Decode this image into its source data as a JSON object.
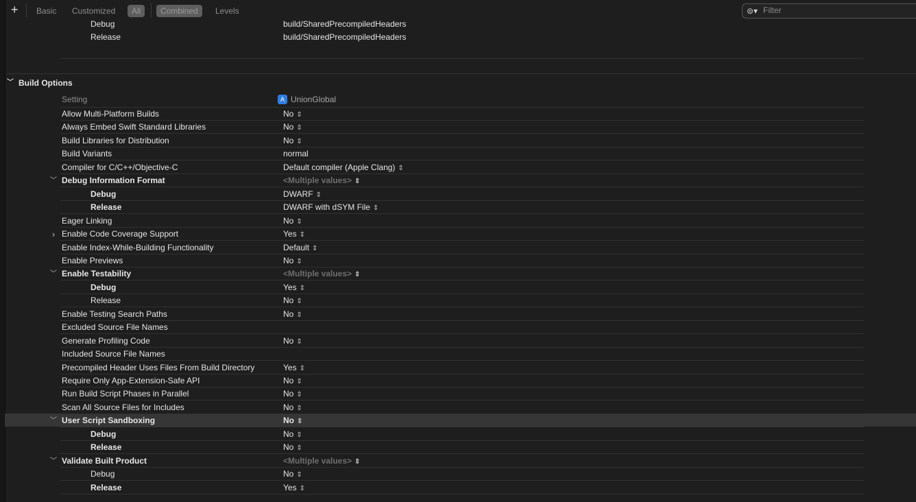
{
  "toolbar": {
    "tabs1": [
      "Basic",
      "Customized",
      "All"
    ],
    "tabs2": [
      "Combined",
      "Levels"
    ],
    "filter_placeholder": "Filter"
  },
  "top_rows": [
    {
      "name": "Debug",
      "value": "build/SharedPrecompiledHeaders"
    },
    {
      "name": "Release",
      "value": "build/SharedPrecompiledHeaders"
    }
  ],
  "section": {
    "title": "Build Options",
    "header_setting": "Setting",
    "header_target": "UnionGlobal"
  },
  "rows": [
    {
      "name": "Allow Multi-Platform Builds",
      "value": "No",
      "stepper": true
    },
    {
      "name": "Always Embed Swift Standard Libraries",
      "value": "No",
      "stepper": true
    },
    {
      "name": "Build Libraries for Distribution",
      "value": "No",
      "stepper": true
    },
    {
      "name": "Build Variants",
      "value": "normal"
    },
    {
      "name": "Compiler for C/C++/Objective-C",
      "value": "Default compiler (Apple Clang)",
      "stepper": true
    },
    {
      "name": "Debug Information Format",
      "value": "<Multiple values>",
      "stepper": true,
      "expanded": true,
      "bold": true,
      "muted": true
    },
    {
      "name": "Debug",
      "value": "DWARF",
      "stepper": true,
      "sub": true,
      "bold": true
    },
    {
      "name": "Release",
      "value": "DWARF with dSYM File",
      "stepper": true,
      "sub": true,
      "bold": true
    },
    {
      "name": "Eager Linking",
      "value": "No",
      "stepper": true
    },
    {
      "name": "Enable Code Coverage Support",
      "value": "Yes",
      "stepper": true,
      "collapsed": true
    },
    {
      "name": "Enable Index-While-Building Functionality",
      "value": "Default",
      "stepper": true
    },
    {
      "name": "Enable Previews",
      "value": "No",
      "stepper": true
    },
    {
      "name": "Enable Testability",
      "value": "<Multiple values>",
      "stepper": true,
      "expanded": true,
      "bold": true,
      "muted": true
    },
    {
      "name": "Debug",
      "value": "Yes",
      "stepper": true,
      "sub": true,
      "bold": true
    },
    {
      "name": "Release",
      "value": "No",
      "stepper": true,
      "sub": true
    },
    {
      "name": "Enable Testing Search Paths",
      "value": "No",
      "stepper": true
    },
    {
      "name": "Excluded Source File Names",
      "value": ""
    },
    {
      "name": "Generate Profiling Code",
      "value": "No",
      "stepper": true
    },
    {
      "name": "Included Source File Names",
      "value": ""
    },
    {
      "name": "Precompiled Header Uses Files From Build Directory",
      "value": "Yes",
      "stepper": true
    },
    {
      "name": "Require Only App-Extension-Safe API",
      "value": "No",
      "stepper": true
    },
    {
      "name": "Run Build Script Phases in Parallel",
      "value": "No",
      "stepper": true
    },
    {
      "name": "Scan All Source Files for Includes",
      "value": "No",
      "stepper": true
    },
    {
      "name": "User Script Sandboxing",
      "value": "No",
      "stepper": true,
      "expanded": true,
      "bold": true,
      "selected": true
    },
    {
      "name": "Debug",
      "value": "No",
      "stepper": true,
      "sub": true,
      "bold": true
    },
    {
      "name": "Release",
      "value": "No",
      "stepper": true,
      "sub": true,
      "bold": true
    },
    {
      "name": "Validate Built Product",
      "value": "<Multiple values>",
      "stepper": true,
      "expanded": true,
      "bold": true,
      "muted": true
    },
    {
      "name": "Debug",
      "value": "No",
      "stepper": true,
      "sub": true
    },
    {
      "name": "Release",
      "value": "Yes",
      "stepper": true,
      "sub": true,
      "bold": true
    }
  ]
}
